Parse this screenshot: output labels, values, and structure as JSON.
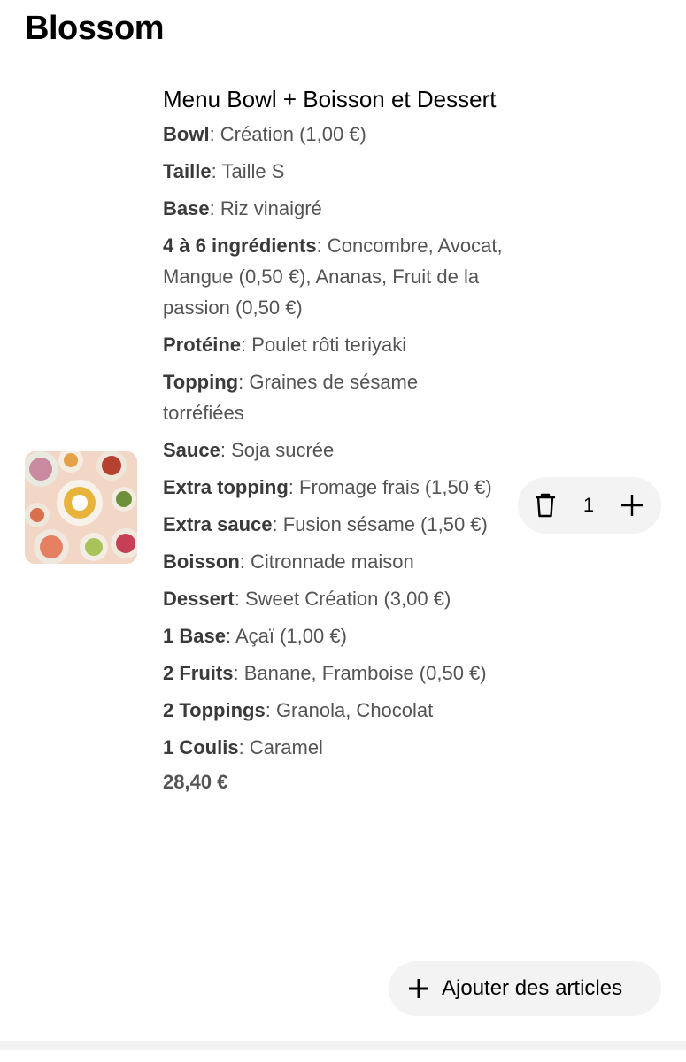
{
  "store": {
    "name": "Blossom"
  },
  "item": {
    "title": "Menu Bowl + Boisson et Dessert",
    "options": [
      {
        "key": "Bowl",
        "value": "Création (1,00 €)"
      },
      {
        "key": "Taille",
        "value": "Taille S"
      },
      {
        "key": "Base",
        "value": "Riz vinaigré"
      },
      {
        "key": "4 à 6 ingrédients",
        "value": "Concombre, Avocat, Mangue (0,50 €), Ananas, Fruit de la passion (0,50 €)"
      },
      {
        "key": "Protéine",
        "value": "Poulet rôti teriyaki"
      },
      {
        "key": "Topping",
        "value": "Graines de sésame torréfiées"
      },
      {
        "key": "Sauce",
        "value": "Soja sucrée"
      },
      {
        "key": "Extra topping",
        "value": "Fromage frais (1,50 €)"
      },
      {
        "key": "Extra sauce",
        "value": "Fusion sésame (1,50 €)"
      },
      {
        "key": "Boisson",
        "value": "Citronnade maison"
      },
      {
        "key": "Dessert",
        "value": "Sweet Création (3,00 €)"
      },
      {
        "key": "1 Base",
        "value": "Açaï (1,00 €)"
      },
      {
        "key": "2 Fruits",
        "value": "Banane, Framboise (0,50 €)"
      },
      {
        "key": "2 Toppings",
        "value": "Granola, Chocolat"
      },
      {
        "key": "1 Coulis",
        "value": "Caramel"
      }
    ],
    "price": "28,40 €",
    "quantity": "1",
    "icons": {
      "remove": "trash-icon",
      "increment": "plus-icon",
      "image": "food-photo"
    }
  },
  "actions": {
    "add_items_label": "Ajouter des articles",
    "add_icon": "plus-icon"
  },
  "colors": {
    "pill_bg": "#f3f3f3",
    "secondary_text": "#545454"
  }
}
